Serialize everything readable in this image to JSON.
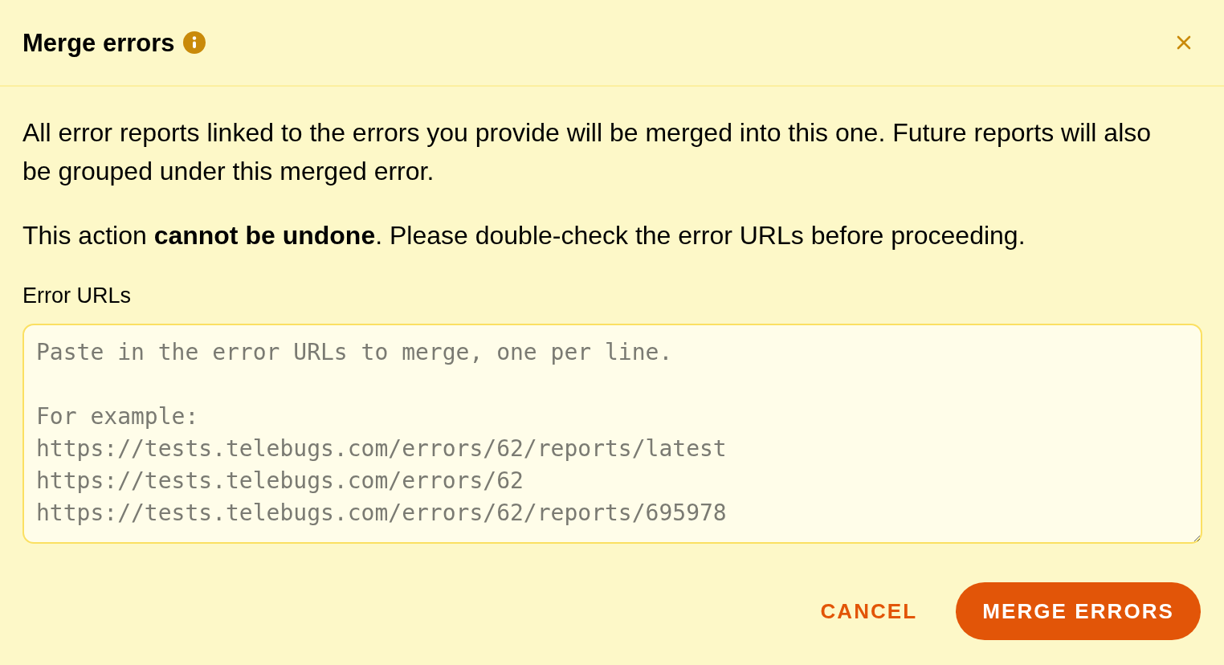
{
  "dialog": {
    "title": "Merge errors"
  },
  "paragraphs": [
    "All error reports linked to the errors you provide will be merged into this one. Future reports will also be grouped under this merged error.",
    "This action **cannot be undone**. Please double-check the error URLs before proceeding."
  ],
  "field": {
    "label": "Error URLs",
    "placeholder": "Paste in the error URLs to merge, one per line.\n\nFor example:\nhttps://tests.telebugs.com/errors/62/reports/latest\nhttps://tests.telebugs.com/errors/62\nhttps://tests.telebugs.com/errors/62/reports/695978"
  },
  "buttons": [
    {
      "label": "CANCEL",
      "kind": "text"
    },
    {
      "label": "MERGE ERRORS",
      "kind": "filled"
    }
  ]
}
